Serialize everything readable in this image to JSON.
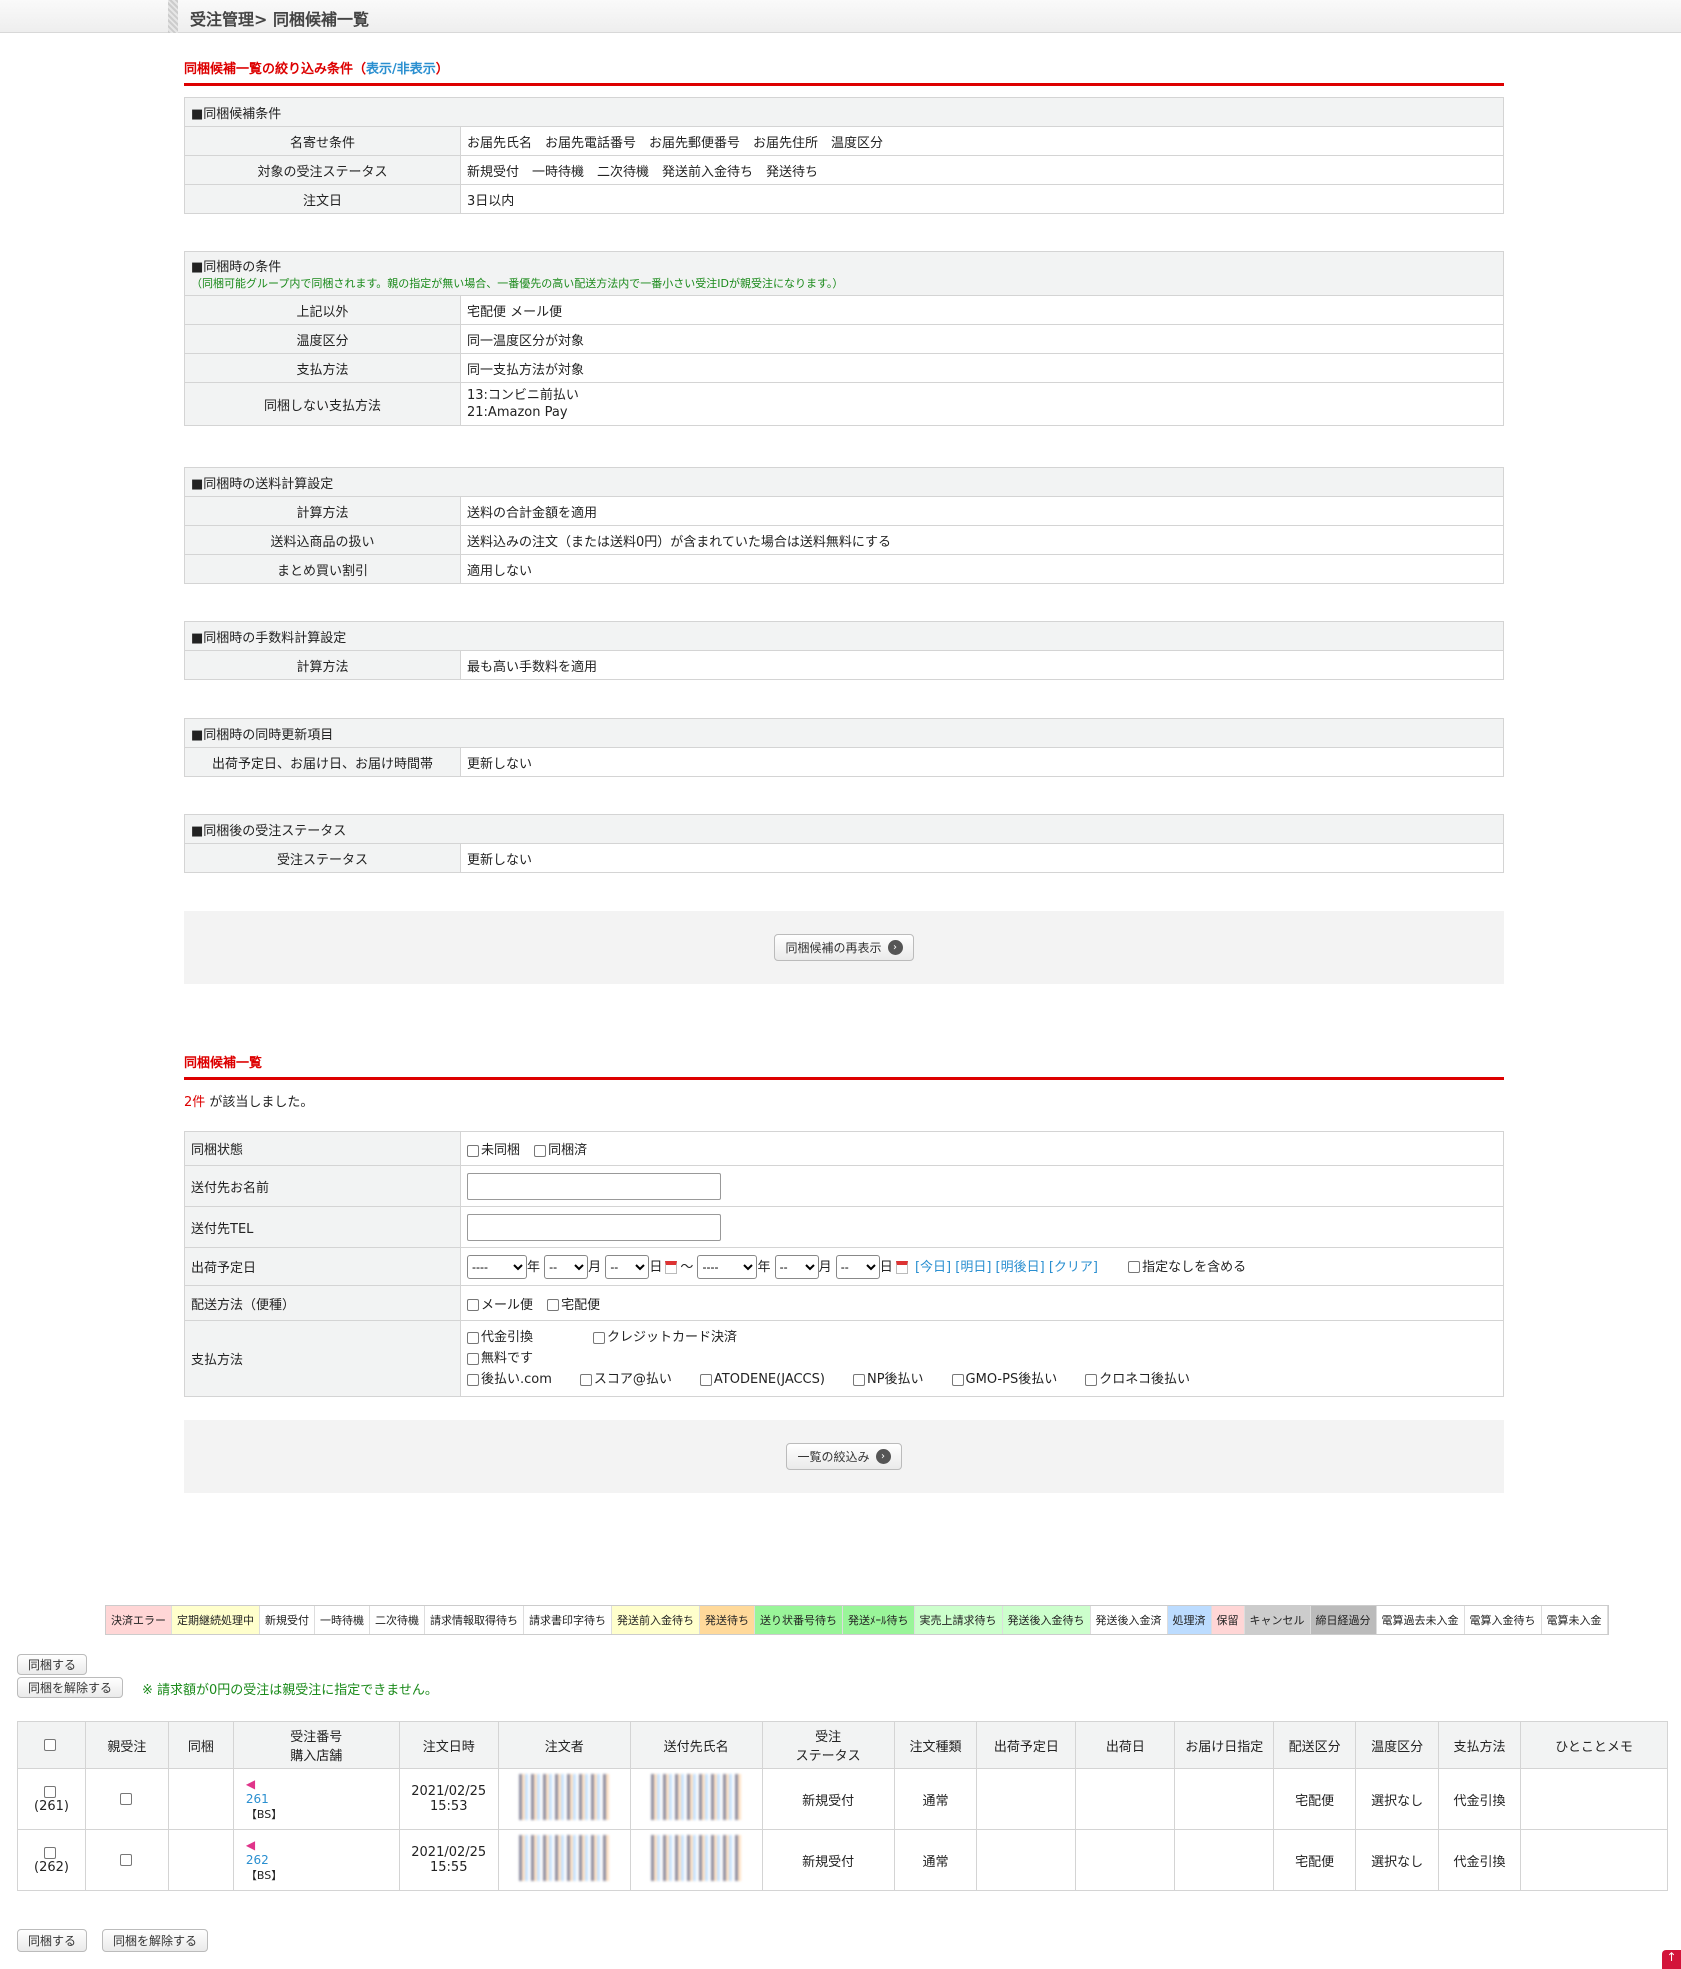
{
  "header": {
    "title": "受注管理> 同梱候補一覧"
  },
  "filter_section": {
    "title": "同梱候補一覧の絞り込み条件（",
    "toggle": "表示/非表示",
    "close": "）"
  },
  "cond1": {
    "title": "■同梱候補条件",
    "rows": [
      {
        "label": "名寄せ条件",
        "value": "お届先氏名　お届先電話番号　お届先郵便番号　お届先住所　温度区分"
      },
      {
        "label": "対象の受注ステータス",
        "value": "新規受付　一時待機　二次待機　発送前入金待ち　発送待ち"
      },
      {
        "label": "注文日",
        "value": "3日以内"
      }
    ]
  },
  "cond2": {
    "title": "■同梱時の条件",
    "note": "（同梱可能グループ内で同梱されます。親の指定が無い場合、一番優先の高い配送方法内で一番小さい受注IDが親受注になります。）",
    "rows": [
      {
        "label": "上記以外",
        "value": "宅配便  メール便"
      },
      {
        "label": "温度区分",
        "value": "同一温度区分が対象"
      },
      {
        "label": "支払方法",
        "value": "同一支払方法が対象"
      }
    ],
    "nobundle_label": "同梱しない支払方法",
    "nobundle_values": [
      "13:コンビニ前払い",
      "21:Amazon Pay"
    ]
  },
  "cond3": {
    "title": "■同梱時の送料計算設定",
    "rows": [
      {
        "label": "計算方法",
        "value": "送料の合計金額を適用"
      },
      {
        "label": "送料込商品の扱い",
        "value": "送料込みの注文（または送料0円）が含まれていた場合は送料無料にする"
      },
      {
        "label": "まとめ買い割引",
        "value": "適用しない"
      }
    ]
  },
  "cond4": {
    "title": "■同梱時の手数料計算設定",
    "rows": [
      {
        "label": "計算方法",
        "value": "最も高い手数料を適用"
      }
    ]
  },
  "cond5": {
    "title": "■同梱時の同時更新項目",
    "rows": [
      {
        "label": "出荷予定日、お届け日、お届け時間帯",
        "value": "更新しない"
      }
    ]
  },
  "cond6": {
    "title": "■同梱後の受注ステータス",
    "rows": [
      {
        "label": "受注ステータス",
        "value": "更新しない"
      }
    ]
  },
  "redisplay_button": "同梱候補の再表示",
  "list_section": {
    "title": "同梱候補一覧",
    "count": "2件",
    "count_suffix": " が該当しました。"
  },
  "form": {
    "bundle_state": {
      "label": "同梱状態",
      "options": [
        "未同梱",
        "同梱済"
      ]
    },
    "name": {
      "label": "送付先お名前",
      "value": ""
    },
    "tel": {
      "label": "送付先TEL",
      "value": ""
    },
    "ship_date": {
      "label": "出荷予定日",
      "year": "----",
      "month": "--",
      "day": "--",
      "y": "年",
      "m": "月",
      "d": "日",
      "tilde": "～",
      "links": [
        "[今日]",
        "[明日]",
        "[明後日]",
        "[クリア]"
      ],
      "include_none": "指定なしを含める"
    },
    "delivery": {
      "label": "配送方法（便種）",
      "options": [
        "メール便",
        "宅配便"
      ]
    },
    "payment": {
      "label": "支払方法",
      "row1": [
        "代金引換",
        "クレジットカード決済"
      ],
      "row2": [
        "無料です"
      ],
      "row3": [
        "後払い.com",
        "スコア@払い",
        "ATODENE(JACCS)",
        "NP後払い",
        "GMO-PS後払い",
        "クロネコ後払い"
      ]
    }
  },
  "filter_button": "一覧の絞込み",
  "legend": [
    {
      "label": "決済エラー",
      "color": "#ffd6d6"
    },
    {
      "label": "定期継続処理中",
      "color": "#ffffcc"
    },
    {
      "label": "新規受付",
      "color": "#ffffff"
    },
    {
      "label": "一時待機",
      "color": "#ffffff"
    },
    {
      "label": "二次待機",
      "color": "#ffffff"
    },
    {
      "label": "請求情報取得待ち",
      "color": "#ffffff"
    },
    {
      "label": "請求書印字待ち",
      "color": "#ffffff"
    },
    {
      "label": "発送前入金待ち",
      "color": "#ffffcc"
    },
    {
      "label": "発送待ち",
      "color": "#ffd99a"
    },
    {
      "label": "送り状番号待ち",
      "color": "#99f599"
    },
    {
      "label": "発送ﾒｰﾙ待ち",
      "color": "#99f599"
    },
    {
      "label": "実売上請求待ち",
      "color": "#ccffcc"
    },
    {
      "label": "発送後入金待ち",
      "color": "#ccffcc"
    },
    {
      "label": "発送後入金済",
      "color": "#ffffff"
    },
    {
      "label": "処理済",
      "color": "#bcdcff"
    },
    {
      "label": "保留",
      "color": "#ffd6d6"
    },
    {
      "label": "キャンセル",
      "color": "#cccccc"
    },
    {
      "label": "締日経過分",
      "color": "#bbbbbb"
    },
    {
      "label": "電算過去未入金",
      "color": "#ffffff"
    },
    {
      "label": "電算入金待ち",
      "color": "#ffffff"
    },
    {
      "label": "電算未入金",
      "color": "#ffffff"
    }
  ],
  "actions": {
    "bundle": "同梱する",
    "unbundle": "同梱を解除する",
    "notice": "※ 請求額が0円の受注は親受注に指定できません。"
  },
  "table": {
    "headers": [
      "",
      "親受注",
      "同梱",
      "受注番号\n購入店舗",
      "注文日時",
      "注文者",
      "送付先氏名",
      "受注\nステータス",
      "注文種類",
      "出荷予定日",
      "出荷日",
      "お届け日指定",
      "配送区分",
      "温度区分",
      "支払方法",
      "ひとことメモ"
    ],
    "rows": [
      {
        "id": "(261)",
        "order_no": "261",
        "shop": "【BS】",
        "date": "2021/02/25",
        "time": "15:53",
        "status": "新規受付",
        "type": "通常",
        "ship_plan": "",
        "shipped": "",
        "delivery_date": "",
        "delivery": "宅配便",
        "temp": "選択なし",
        "payment": "代金引換",
        "memo": ""
      },
      {
        "id": "(262)",
        "order_no": "262",
        "shop": "【BS】",
        "date": "2021/02/25",
        "time": "15:55",
        "status": "新規受付",
        "type": "通常",
        "ship_plan": "",
        "shipped": "",
        "delivery_date": "",
        "delivery": "宅配便",
        "temp": "選択なし",
        "payment": "代金引換",
        "memo": ""
      }
    ]
  }
}
